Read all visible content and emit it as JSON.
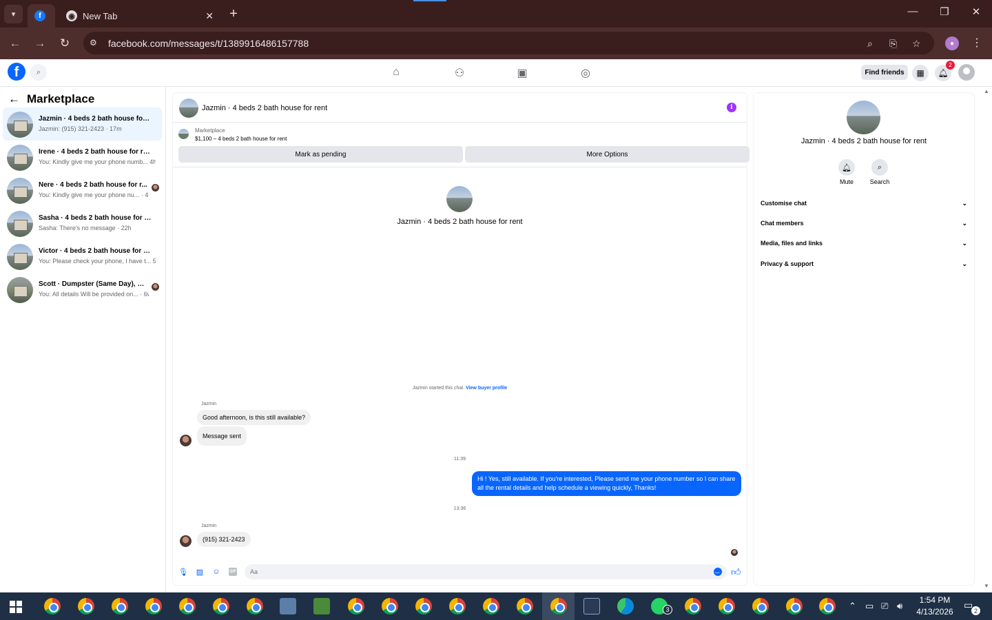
{
  "browser": {
    "tabs": [
      {
        "title": "",
        "favicon": "facebook-icon"
      },
      {
        "title": "New Tab",
        "favicon": "chrome-icon"
      }
    ],
    "new_tab_label": "+",
    "url": "facebook.com/messages/t/1389916486157788"
  },
  "fb_header": {
    "find_friends": "Find friends",
    "notifications_count": "2"
  },
  "sidebar": {
    "title": "Marketplace",
    "conversations": [
      {
        "title": "Jazmin · 4 beds 2 bath house for r...",
        "subtitle": "Jazmin: (915) 321-2423 · 17m"
      },
      {
        "title": "Irene · 4 beds 2 bath house for rent",
        "subtitle": "You: Kindly give me your phone numb... 4h"
      },
      {
        "title": "Nere · 4 beds 2 bath house for r...",
        "subtitle": "You: Kindly give me your phone nu... · 4h"
      },
      {
        "title": "Sasha · 4 beds 2 bath house for rent",
        "subtitle": "Sasha: There's no message · 22h"
      },
      {
        "title": "Victor · 4 beds 2 bath house for rent",
        "subtitle": "You: Please check your phone, I have t... 5d"
      },
      {
        "title": "Scott · Dumpster (Same Day), R...",
        "subtitle": "You: All details Will be provided on... · 6w"
      }
    ]
  },
  "chat": {
    "title": "Jazmin · 4 beds 2 bath house for rent",
    "listing": {
      "label": "Marketplace",
      "price_title": "$1,100 – 4 beds 2 bath house for rent",
      "mark_pending": "Mark as pending",
      "more_options": "More Options"
    },
    "intro_name": "Jazmin · 4 beds 2 bath house for rent",
    "started_note": "Jazmin started this chat.",
    "view_profile": "View buyer profile",
    "sender_1": "Jazmin",
    "msg_1": "Good afternoon, is this still available?",
    "msg_2": "Message sent",
    "time_1": "11:39",
    "msg_out": "Hi ! Yes, still available. If you're interested, Please send me your phone number so I can share all the rental details and help schedule a viewing quickly, Thanks!",
    "time_2": "13:36",
    "sender_2": "Jazmin",
    "msg_3": "(915) 321-2423",
    "composer_placeholder": "Aa",
    "gif_label": "GIF"
  },
  "info_panel": {
    "name": "Jazmin · 4 beds 2 bath house for rent",
    "mute": "Mute",
    "search": "Search",
    "sections": [
      "Customise chat",
      "Chat members",
      "Media, files and links",
      "Privacy & support"
    ]
  },
  "taskbar": {
    "whatsapp_badge": "3",
    "time": "1:54 PM",
    "date": "4/13/2026",
    "notification_count": "2"
  }
}
